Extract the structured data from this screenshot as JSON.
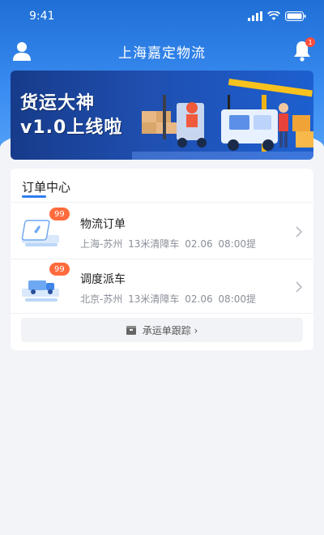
{
  "status_bar": {
    "time": "9:41"
  },
  "nav": {
    "title": "上海嘉定物流",
    "notification_count": "1"
  },
  "banner": {
    "line1": "货运大神",
    "line2": "v1.0上线啦"
  },
  "order_center": {
    "title": "订单中心",
    "items": [
      {
        "name": "物流订单",
        "badge": "99",
        "route": "上海-苏州 13米清障车 02.06 08:00提"
      },
      {
        "name": "调度派车",
        "badge": "99",
        "route": "北京-苏州 13米清障车 02.06 08:00提"
      }
    ],
    "track_label": "承运单跟踪 ›"
  },
  "colors": {
    "brand_blue": "#2f7df0",
    "badge_orange": "#ff6b3d",
    "notify_red": "#ff4d3a"
  }
}
